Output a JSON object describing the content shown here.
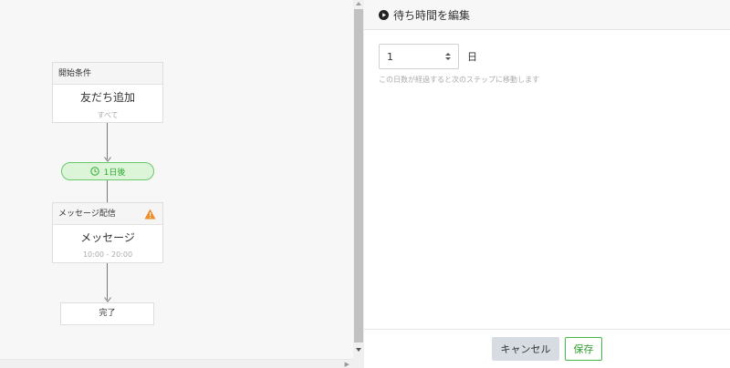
{
  "flow": {
    "trigger": {
      "header": "開始条件",
      "title": "友だち追加",
      "subtitle": "すべて"
    },
    "wait": {
      "label": "1日後",
      "icon": "clock-icon"
    },
    "message": {
      "header": "メッセージ配信",
      "title": "メッセージ",
      "subtitle": "10:00 - 20:00",
      "warning_icon": "warning-icon"
    },
    "end": {
      "label": "完了"
    }
  },
  "panel": {
    "title": "待ち時間を編集",
    "days_value": "1",
    "days_unit": "日",
    "help_text": "この日数が経過すると次のステップに移動します",
    "cancel_label": "キャンセル",
    "save_label": "保存"
  },
  "colors": {
    "accent_green": "#31a831",
    "pill_bg": "#dcf5d9",
    "warning": "#f08c2c",
    "cancel_bg": "#d7dce2"
  }
}
